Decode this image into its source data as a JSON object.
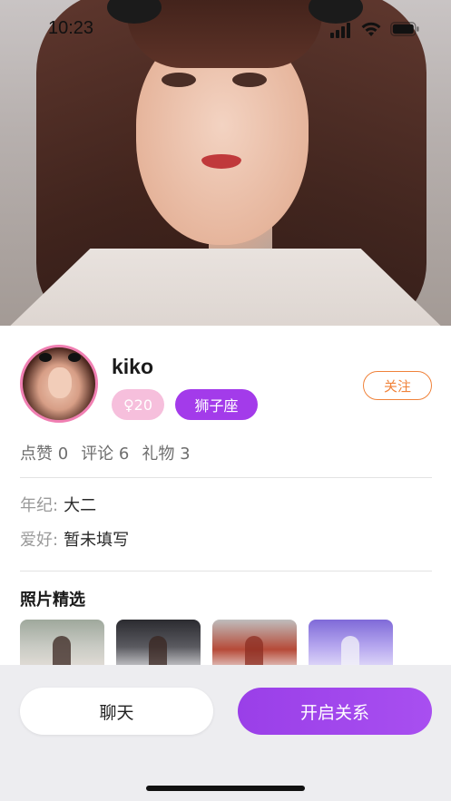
{
  "status_bar": {
    "time": "10:23",
    "signal_icon": "cellular-signal-icon",
    "wifi_icon": "wifi-icon",
    "battery_icon": "battery-icon"
  },
  "hero": {
    "photo": "profile-cover-photo"
  },
  "profile": {
    "name": "kiko",
    "age_tag": "♀20",
    "zodiac_tag": "狮子座",
    "follow_label": "关注"
  },
  "stats": {
    "likes": "点赞 0",
    "comments": "评论 6",
    "gifts": "礼物 3"
  },
  "details": {
    "grade_label": "年纪:",
    "grade_value": "大二",
    "hobby_label": "爱好:",
    "hobby_value": "暂未填写"
  },
  "photos": {
    "title": "照片精选",
    "count_visible": 4
  },
  "actions": {
    "chat_label": "聊天",
    "relationship_label": "开启关系"
  },
  "colors": {
    "avatar_ring": "#f07fb2",
    "age_tag_bg": "#f6bfdc",
    "zodiac_tag_bg": "#a33bea",
    "follow_accent": "#f0823a",
    "primary_purple": "#a84ff0"
  }
}
